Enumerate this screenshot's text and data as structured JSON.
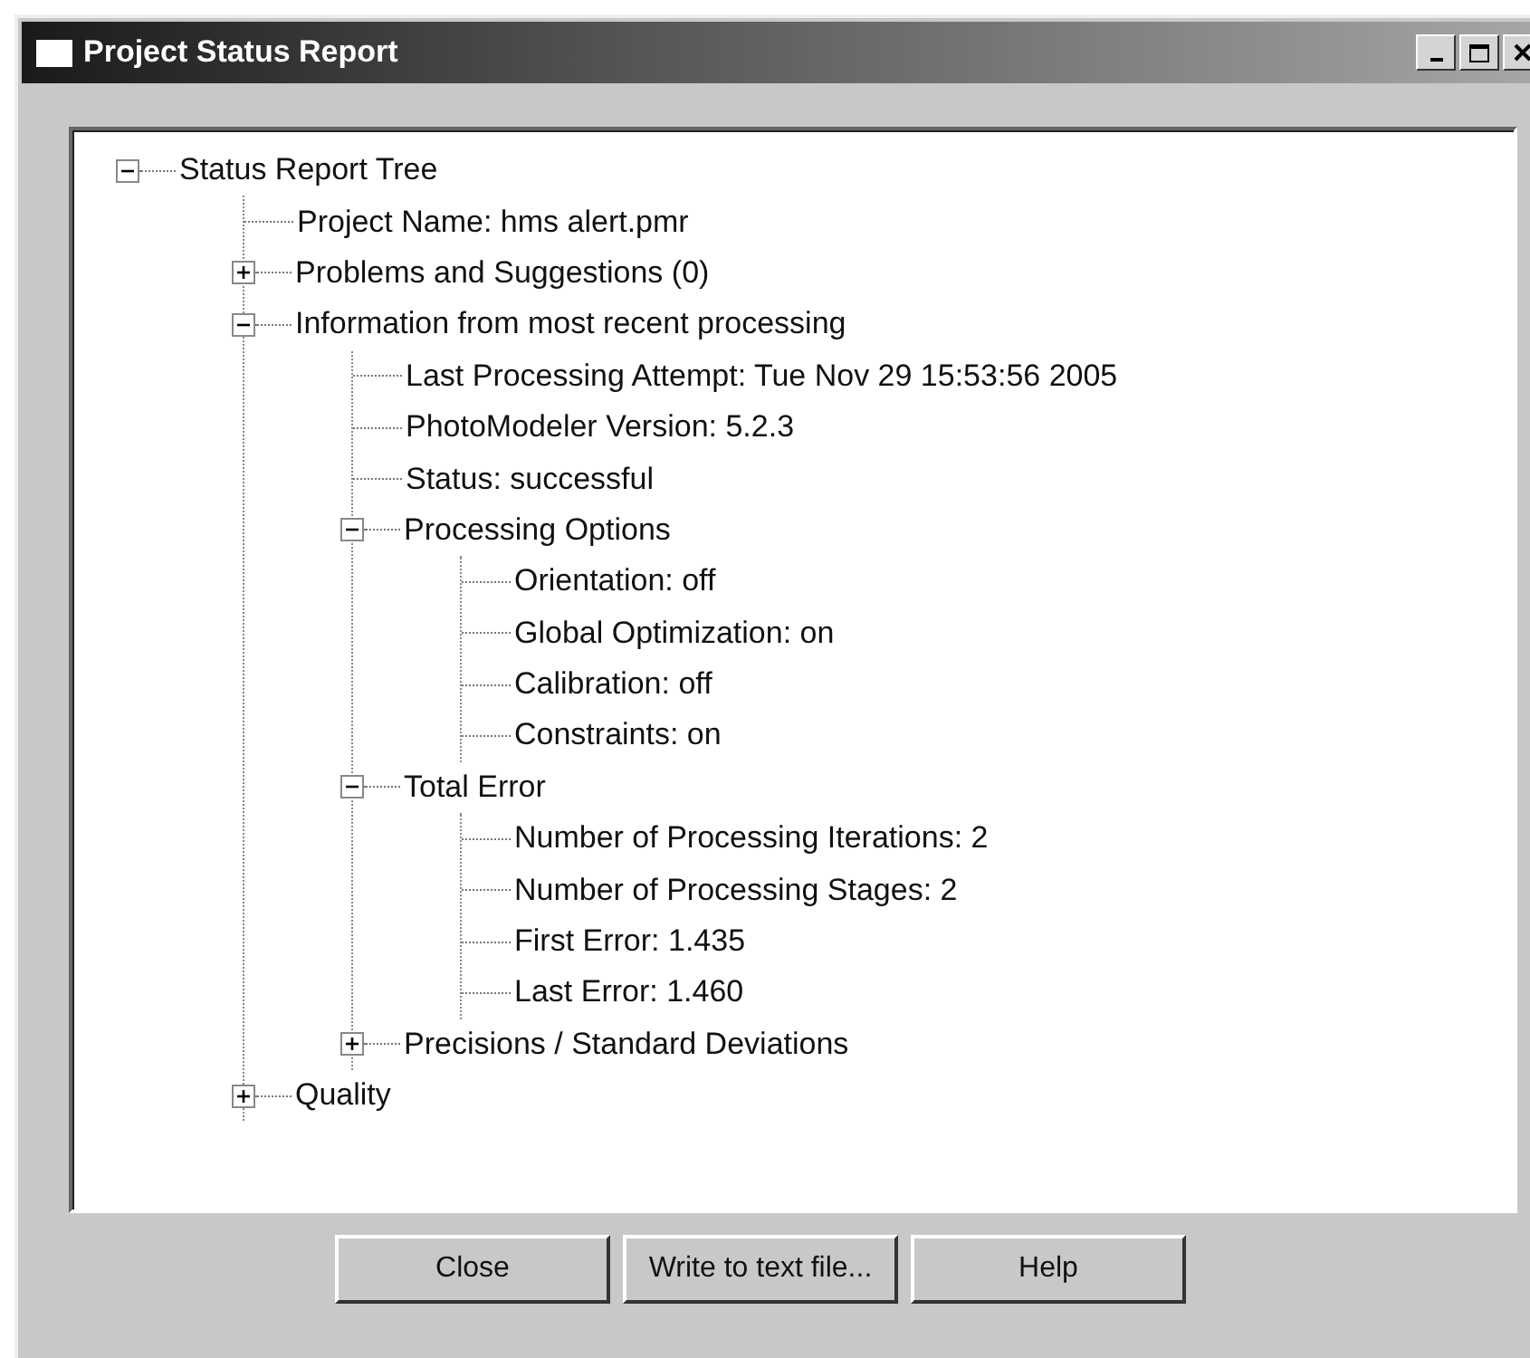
{
  "window": {
    "title": "Project Status Report"
  },
  "tree": [
    {
      "label": "Status Report Tree",
      "expanded": true,
      "children": [
        {
          "label": "Project Name: hms alert.pmr"
        },
        {
          "label": "Problems and Suggestions (0)",
          "expanded": false
        },
        {
          "label": "Information from most recent processing",
          "expanded": true,
          "children": [
            {
              "label": "Last Processing Attempt: Tue Nov 29 15:53:56 2005"
            },
            {
              "label": "PhotoModeler Version: 5.2.3"
            },
            {
              "label": "Status: successful"
            },
            {
              "label": "Processing Options",
              "expanded": true,
              "children": [
                {
                  "label": "Orientation: off"
                },
                {
                  "label": "Global Optimization: on"
                },
                {
                  "label": "Calibration: off"
                },
                {
                  "label": "Constraints: on"
                }
              ]
            },
            {
              "label": "Total Error",
              "expanded": true,
              "children": [
                {
                  "label": "Number of Processing Iterations: 2"
                },
                {
                  "label": "Number of Processing Stages: 2"
                },
                {
                  "label": "First Error: 1.435"
                },
                {
                  "label": "Last Error: 1.460"
                }
              ]
            },
            {
              "label": "Precisions / Standard Deviations",
              "expanded": false
            }
          ]
        },
        {
          "label": "Quality",
          "expanded": false
        }
      ]
    }
  ],
  "buttons": [
    "Close",
    "Write to text file...",
    "Help"
  ]
}
